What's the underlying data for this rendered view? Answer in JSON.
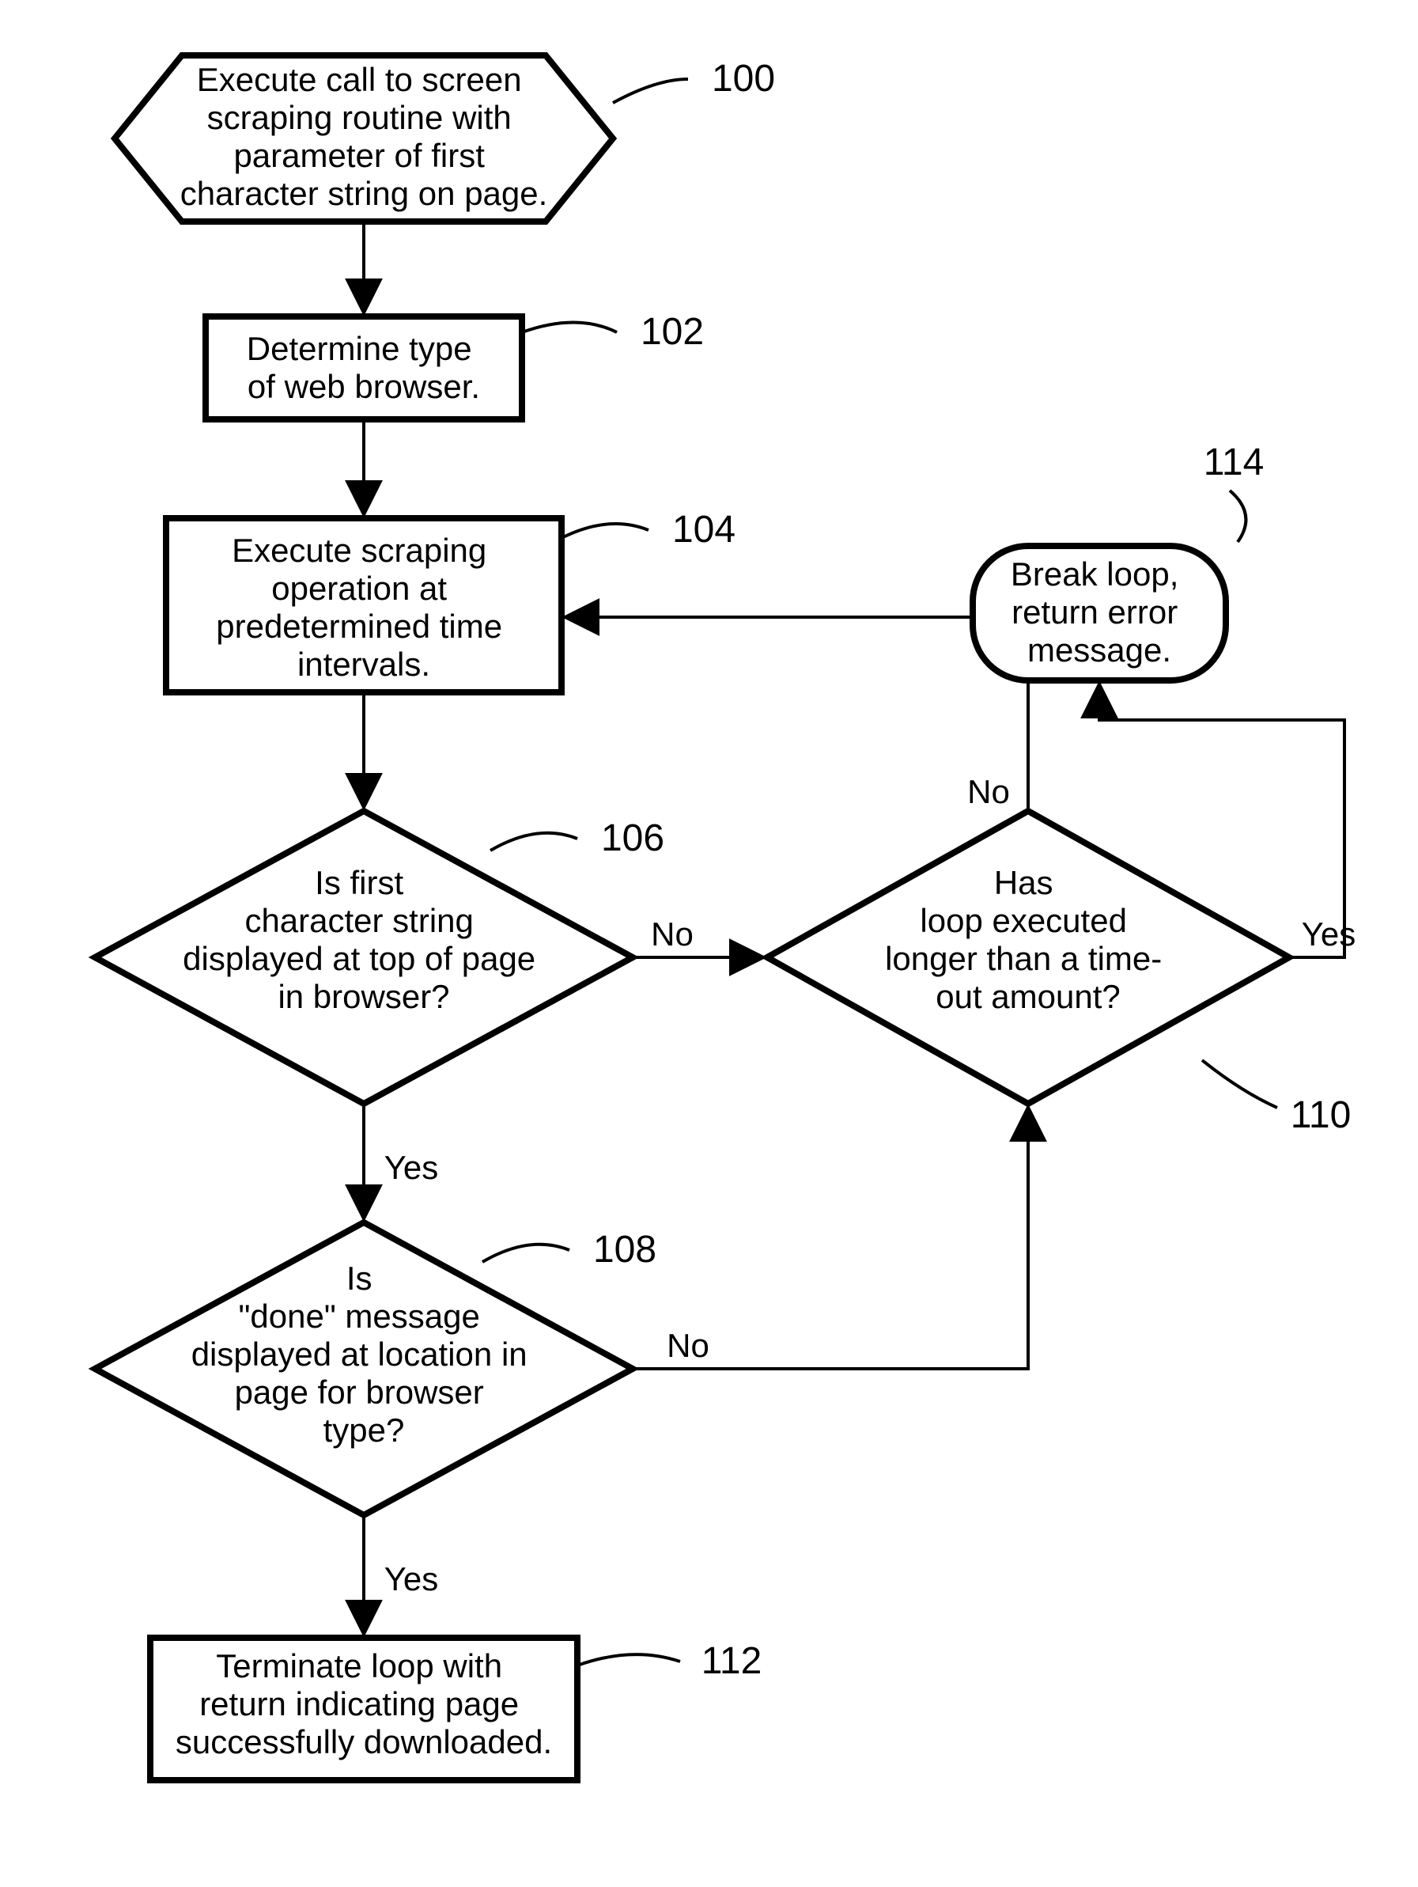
{
  "nodes": {
    "n100": {
      "text": [
        "Execute call to screen",
        "scraping routine with",
        "parameter of first",
        "character string on page."
      ],
      "label": "100"
    },
    "n102": {
      "text": [
        "Determine type",
        "of web browser."
      ],
      "label": "102"
    },
    "n104": {
      "text": [
        "Execute scraping",
        "operation at",
        "predetermined time",
        "intervals."
      ],
      "label": "104"
    },
    "n106": {
      "text": [
        "Is first",
        "character string",
        "displayed at top of page",
        "in browser?"
      ],
      "label": "106"
    },
    "n108": {
      "text": [
        "Is",
        "\"done\" message",
        "displayed at location in",
        "page for browser",
        "type?"
      ],
      "label": "108"
    },
    "n110": {
      "text": [
        "Has",
        "loop executed",
        "longer than a time-",
        "out amount?"
      ],
      "label": "110"
    },
    "n112": {
      "text": [
        "Terminate loop with",
        "return indicating page",
        "successfully downloaded."
      ],
      "label": "112"
    },
    "n114": {
      "text": [
        "Break loop,",
        "return error",
        "message."
      ],
      "label": "114"
    }
  },
  "edges": {
    "e106no": "No",
    "e106yes": "Yes",
    "e108no": "No",
    "e108yes": "Yes",
    "e110no": "No",
    "e110yes": "Yes"
  }
}
